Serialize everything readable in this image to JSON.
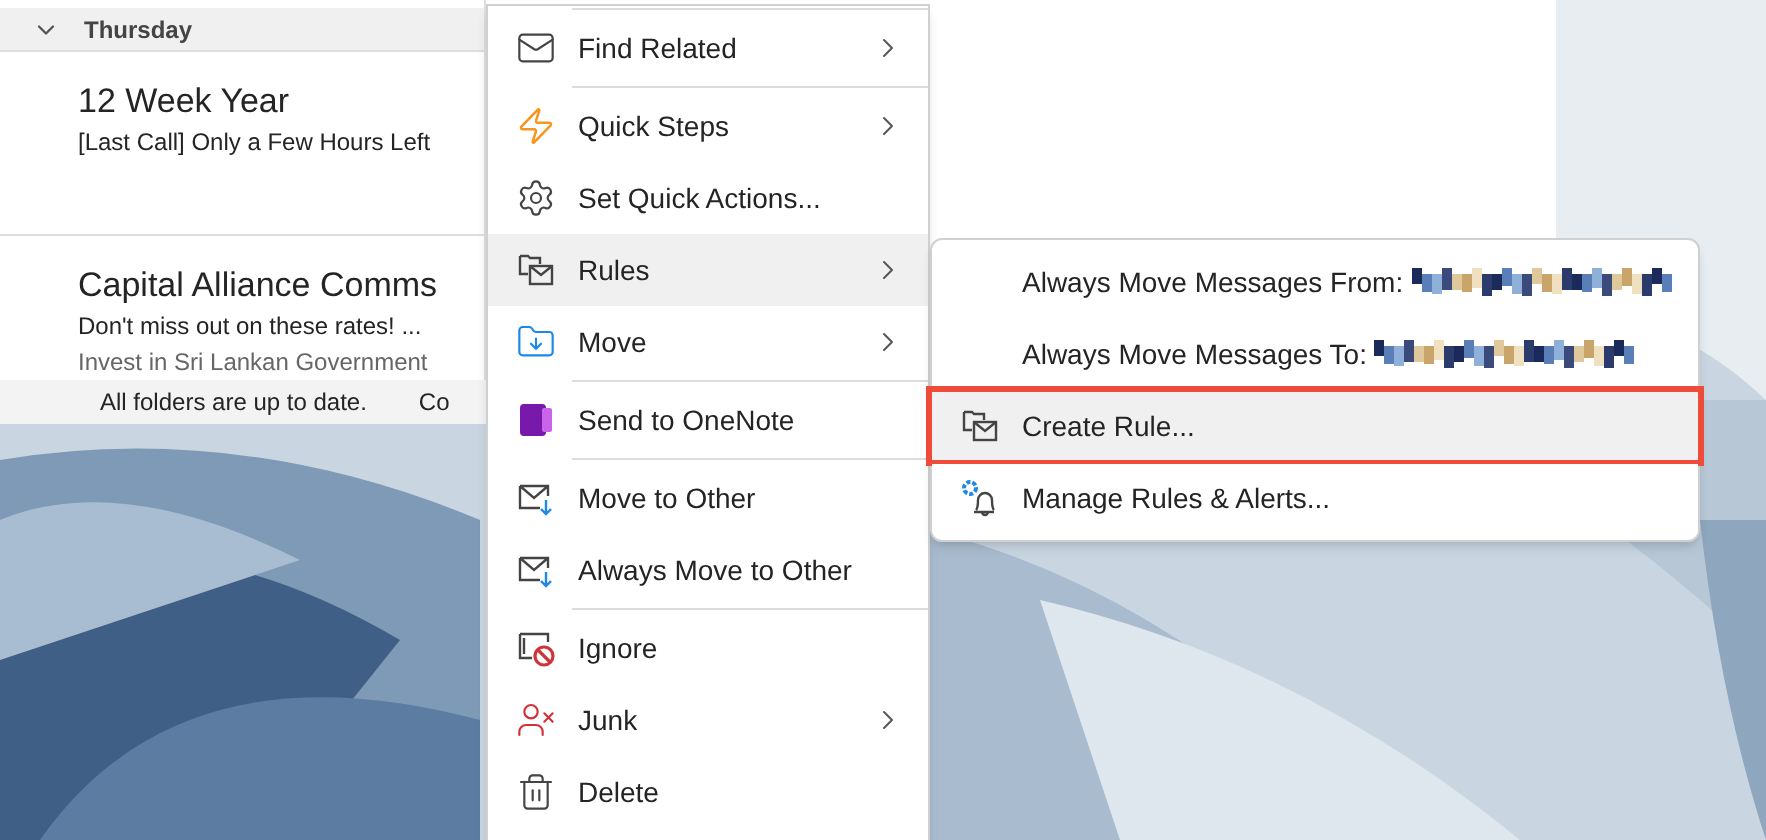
{
  "message_list": {
    "group_header": {
      "label": "Thursday",
      "expanded": true
    },
    "messages": [
      {
        "sender": "12 Week Year",
        "subject": "[Last Call] Only a Few Hours Left"
      },
      {
        "sender": "Capital Alliance Comms",
        "subject": "Don't miss out on these rates! ...",
        "preview": "Invest in Sri Lankan Government"
      }
    ]
  },
  "status_bar": {
    "items": [
      "All folders are up to date.",
      "Co"
    ]
  },
  "context_menu": {
    "items": [
      {
        "label": "Find Related",
        "separator_above": true,
        "submenu": true,
        "selected": false
      },
      {
        "label": "Quick Steps",
        "separator_above": true,
        "submenu": true,
        "selected": false
      },
      {
        "label": "Set Quick Actions...",
        "separator_above": false,
        "submenu": false,
        "selected": false
      },
      {
        "label": "Rules",
        "separator_above": false,
        "submenu": true,
        "selected": true
      },
      {
        "label": "Move",
        "separator_above": false,
        "submenu": true,
        "selected": false
      },
      {
        "label": "Send to OneNote",
        "separator_above": true,
        "submenu": false,
        "selected": false
      },
      {
        "label": "Move to Other",
        "separator_above": true,
        "submenu": false,
        "selected": false
      },
      {
        "label": "Always Move to Other",
        "separator_above": false,
        "submenu": false,
        "selected": false
      },
      {
        "label": "Ignore",
        "separator_above": true,
        "submenu": false,
        "selected": false
      },
      {
        "label": "Junk",
        "separator_above": false,
        "submenu": true,
        "selected": false
      },
      {
        "label": "Delete",
        "separator_above": false,
        "submenu": false,
        "selected": false
      }
    ]
  },
  "rules_submenu": {
    "items": [
      {
        "label": "Always Move Messages From:",
        "redacted": true,
        "selected": false,
        "annotated": false
      },
      {
        "label": "Always Move Messages To:",
        "redacted": true,
        "selected": false,
        "annotated": false
      },
      {
        "label": "Create Rule...",
        "redacted": false,
        "selected": true,
        "annotated": true
      },
      {
        "label": "Manage Rules & Alerts...",
        "redacted": false,
        "selected": false,
        "annotated": false
      }
    ]
  }
}
